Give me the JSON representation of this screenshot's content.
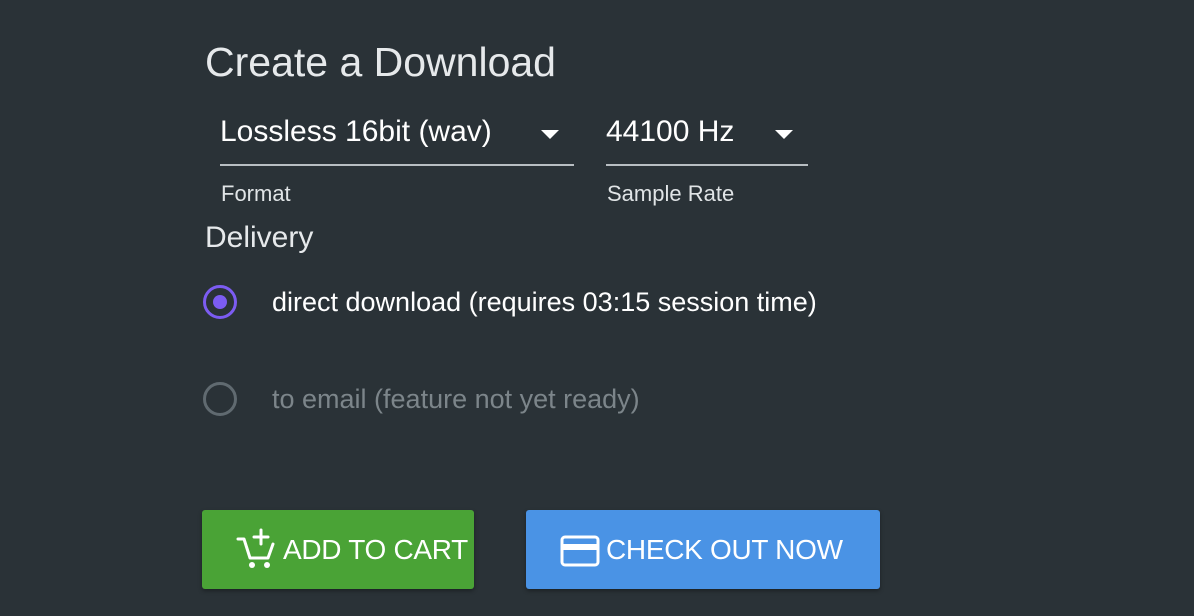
{
  "page": {
    "title": "Create a Download"
  },
  "format": {
    "value": "Lossless 16bit (wav)",
    "label": "Format"
  },
  "sample_rate": {
    "value": "44100 Hz",
    "label": "Sample Rate"
  },
  "delivery": {
    "label": "Delivery",
    "options": [
      {
        "label": "direct download (requires 03:15 session time)",
        "selected": true,
        "enabled": true
      },
      {
        "label": "to email (feature not yet ready)",
        "selected": false,
        "enabled": false
      }
    ]
  },
  "actions": {
    "add_to_cart": {
      "label": "ADD TO CART",
      "icon": "cart-plus-icon",
      "color": "#4aa336"
    },
    "check_out": {
      "label": "CHECK OUT NOW",
      "icon": "credit-card-icon",
      "color": "#4a93e5"
    }
  },
  "colors": {
    "background": "#2a3237",
    "radio_accent": "#7c5cf2"
  }
}
